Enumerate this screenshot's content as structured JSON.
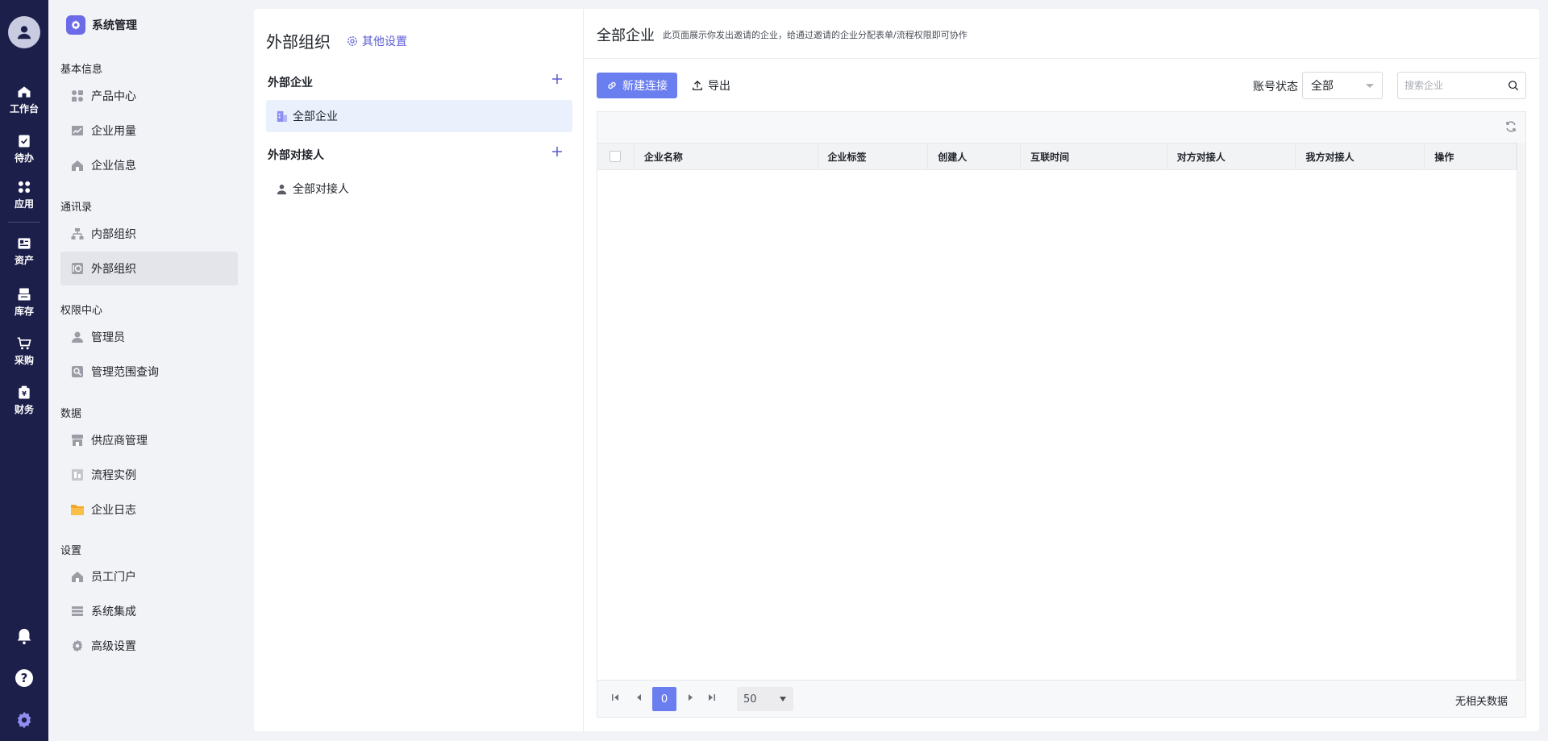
{
  "rail": {
    "items": [
      {
        "label": "工作台",
        "icon": "home-icon"
      },
      {
        "label": "待办",
        "icon": "todo-icon"
      },
      {
        "label": "应用",
        "icon": "apps-icon"
      },
      {
        "label": "资产",
        "icon": "asset-icon"
      },
      {
        "label": "库存",
        "icon": "inventory-icon"
      },
      {
        "label": "采购",
        "icon": "cart-icon"
      },
      {
        "label": "财务",
        "icon": "finance-icon"
      }
    ]
  },
  "sidebar": {
    "title": "系统管理",
    "groups": [
      {
        "label": "基本信息",
        "items": [
          {
            "label": "产品中心",
            "icon": "product-icon"
          },
          {
            "label": "企业用量",
            "icon": "usage-icon"
          },
          {
            "label": "企业信息",
            "icon": "company-icon"
          }
        ]
      },
      {
        "label": "通讯录",
        "items": [
          {
            "label": "内部组织",
            "icon": "org-icon"
          },
          {
            "label": "外部组织",
            "icon": "external-org-icon"
          }
        ]
      },
      {
        "label": "权限中心",
        "items": [
          {
            "label": "管理员",
            "icon": "admin-icon"
          },
          {
            "label": "管理范围查询",
            "icon": "scope-search-icon"
          }
        ]
      },
      {
        "label": "数据",
        "items": [
          {
            "label": "供应商管理",
            "icon": "supplier-icon"
          },
          {
            "label": "流程实例",
            "icon": "process-icon"
          },
          {
            "label": "企业日志",
            "icon": "folder-icon"
          }
        ]
      },
      {
        "label": "设置",
        "items": [
          {
            "label": "员工门户",
            "icon": "portal-icon"
          },
          {
            "label": "系统集成",
            "icon": "integration-icon"
          },
          {
            "label": "高级设置",
            "icon": "gear-icon"
          }
        ]
      }
    ],
    "active": "外部组织"
  },
  "left_panel": {
    "title": "外部组织",
    "settings_label": "其他设置",
    "sections": [
      {
        "label": "外部企业",
        "items": [
          {
            "label": "全部企业"
          }
        ]
      },
      {
        "label": "外部对接人",
        "items": [
          {
            "label": "全部对接人"
          }
        ]
      }
    ]
  },
  "main": {
    "title": "全部企业",
    "description": "此页面展示你发出邀请的企业，给通过邀请的企业分配表单/流程权限即可协作",
    "new_button": "新建连接",
    "export_button": "导出",
    "status_label": "账号状态",
    "status_value": "全部",
    "search_placeholder": "搜索企业",
    "columns": [
      "企业名称",
      "企业标签",
      "创建人",
      "互联时间",
      "对方对接人",
      "我方对接人",
      "操作"
    ],
    "pagination": {
      "current_page": "0",
      "page_size": "50",
      "empty_text": "无相关数据"
    }
  },
  "colors": {
    "accent": "#6b7ef0",
    "rail_bg": "#1c1f4a",
    "brand": "#6b6be8"
  }
}
